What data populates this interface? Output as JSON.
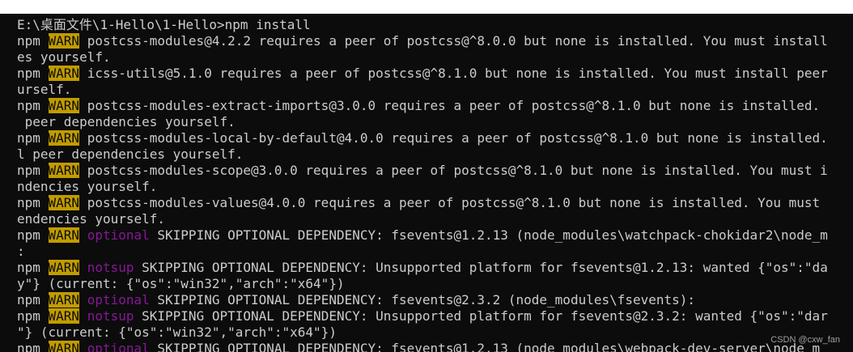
{
  "terminal": {
    "lines": [
      {
        "segments": [
          {
            "text": "E:\\桌面文件\\1-Hello\\1-Hello>npm install",
            "cls": ""
          }
        ]
      },
      {
        "segments": [
          {
            "text": "npm ",
            "cls": ""
          },
          {
            "text": "WARN",
            "cls": "warn"
          },
          {
            "text": " postcss-modules@4.2.2 requires a peer of postcss@^8.0.0 but none is installed. You must install",
            "cls": ""
          }
        ]
      },
      {
        "segments": [
          {
            "text": "es yourself.",
            "cls": ""
          }
        ]
      },
      {
        "segments": [
          {
            "text": "npm ",
            "cls": ""
          },
          {
            "text": "WARN",
            "cls": "warn"
          },
          {
            "text": " icss-utils@5.1.0 requires a peer of postcss@^8.1.0 but none is installed. You must install peer",
            "cls": ""
          }
        ]
      },
      {
        "segments": [
          {
            "text": "urself.",
            "cls": ""
          }
        ]
      },
      {
        "segments": [
          {
            "text": "npm ",
            "cls": ""
          },
          {
            "text": "WARN",
            "cls": "warn"
          },
          {
            "text": " postcss-modules-extract-imports@3.0.0 requires a peer of postcss@^8.1.0 but none is installed.",
            "cls": ""
          }
        ]
      },
      {
        "segments": [
          {
            "text": " peer dependencies yourself.",
            "cls": ""
          }
        ]
      },
      {
        "segments": [
          {
            "text": "npm ",
            "cls": ""
          },
          {
            "text": "WARN",
            "cls": "warn"
          },
          {
            "text": " postcss-modules-local-by-default@4.0.0 requires a peer of postcss@^8.1.0 but none is installed.",
            "cls": ""
          }
        ]
      },
      {
        "segments": [
          {
            "text": "l peer dependencies yourself.",
            "cls": ""
          }
        ]
      },
      {
        "segments": [
          {
            "text": "npm ",
            "cls": ""
          },
          {
            "text": "WARN",
            "cls": "warn"
          },
          {
            "text": " postcss-modules-scope@3.0.0 requires a peer of postcss@^8.1.0 but none is installed. You must i",
            "cls": ""
          }
        ]
      },
      {
        "segments": [
          {
            "text": "ndencies yourself.",
            "cls": ""
          }
        ]
      },
      {
        "segments": [
          {
            "text": "npm ",
            "cls": ""
          },
          {
            "text": "WARN",
            "cls": "warn"
          },
          {
            "text": " postcss-modules-values@4.0.0 requires a peer of postcss@^8.1.0 but none is installed. You must",
            "cls": ""
          }
        ]
      },
      {
        "segments": [
          {
            "text": "endencies yourself.",
            "cls": ""
          }
        ]
      },
      {
        "segments": [
          {
            "text": "npm ",
            "cls": ""
          },
          {
            "text": "WARN",
            "cls": "warn"
          },
          {
            "text": " ",
            "cls": ""
          },
          {
            "text": "optional",
            "cls": "tag"
          },
          {
            "text": " SKIPPING OPTIONAL DEPENDENCY: fsevents@1.2.13 (node_modules\\watchpack-chokidar2\\node_m",
            "cls": ""
          }
        ]
      },
      {
        "segments": [
          {
            "text": ":",
            "cls": ""
          }
        ]
      },
      {
        "segments": [
          {
            "text": "npm ",
            "cls": ""
          },
          {
            "text": "WARN",
            "cls": "warn"
          },
          {
            "text": " ",
            "cls": ""
          },
          {
            "text": "notsup",
            "cls": "tag"
          },
          {
            "text": " SKIPPING OPTIONAL DEPENDENCY: Unsupported platform for fsevents@1.2.13: wanted {\"os\":\"da",
            "cls": ""
          }
        ]
      },
      {
        "segments": [
          {
            "text": "y\"} (current: {\"os\":\"win32\",\"arch\":\"x64\"})",
            "cls": ""
          }
        ]
      },
      {
        "segments": [
          {
            "text": "npm ",
            "cls": ""
          },
          {
            "text": "WARN",
            "cls": "warn"
          },
          {
            "text": " ",
            "cls": ""
          },
          {
            "text": "optional",
            "cls": "tag"
          },
          {
            "text": " SKIPPING OPTIONAL DEPENDENCY: fsevents@2.3.2 (node_modules\\fsevents):",
            "cls": ""
          }
        ]
      },
      {
        "segments": [
          {
            "text": "npm ",
            "cls": ""
          },
          {
            "text": "WARN",
            "cls": "warn"
          },
          {
            "text": " ",
            "cls": ""
          },
          {
            "text": "notsup",
            "cls": "tag"
          },
          {
            "text": " SKIPPING OPTIONAL DEPENDENCY: Unsupported platform for fsevents@2.3.2: wanted {\"os\":\"dar",
            "cls": ""
          }
        ]
      },
      {
        "segments": [
          {
            "text": "\"} (current: {\"os\":\"win32\",\"arch\":\"x64\"})",
            "cls": ""
          }
        ]
      },
      {
        "segments": [
          {
            "text": "npm ",
            "cls": ""
          },
          {
            "text": "WARN",
            "cls": "warn"
          },
          {
            "text": " ",
            "cls": ""
          },
          {
            "text": "optional",
            "cls": "tag"
          },
          {
            "text": " SKIPPING OPTIONAL DEPENDENCY: fsevents@1.2.13 (node_modules\\webpack-dev-server\\node_m",
            "cls": ""
          }
        ]
      }
    ]
  },
  "watermark": "CSDN @cxw_fan",
  "colors": {
    "background": "#0c0c0c",
    "foreground": "#cccccc",
    "warn_bg": "#c19c00",
    "tag": "#881798"
  }
}
